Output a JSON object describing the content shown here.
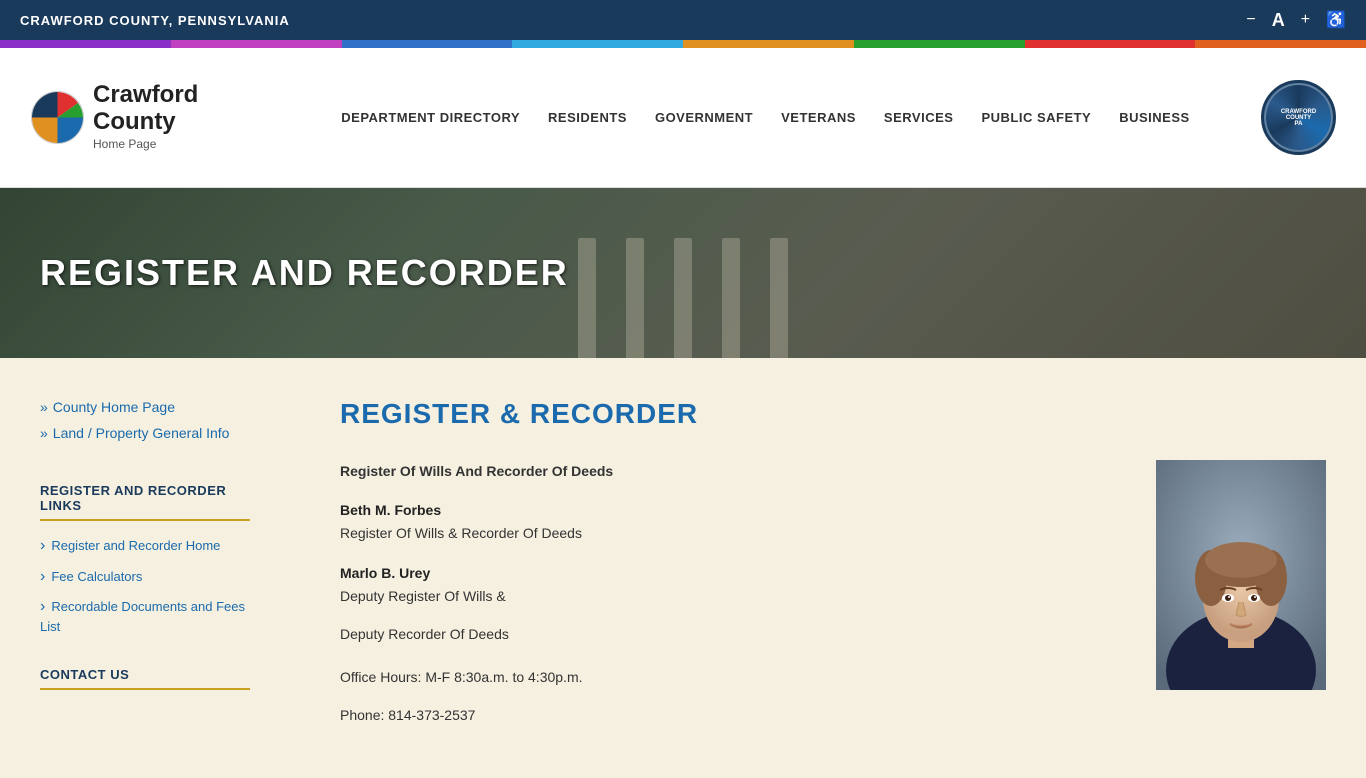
{
  "topBar": {
    "title": "CRAWFORD COUNTY, PENNSYLVANIA",
    "controls": {
      "decrease": "−",
      "font": "A",
      "increase": "+",
      "accessibility": "♿"
    }
  },
  "colorStripe": [
    "#8b2fc9",
    "#c040c0",
    "#3070c8",
    "#30a8e0",
    "#e09020",
    "#28a030",
    "#e03030",
    "#e06020"
  ],
  "logo": {
    "name": "Crawford",
    "name2": "County",
    "subtext": "Home Page"
  },
  "nav": {
    "items": [
      "DEPARTMENT DIRECTORY",
      "RESIDENTS",
      "GOVERNMENT",
      "VETERANS",
      "SERVICES",
      "PUBLIC SAFETY",
      "BUSINESS"
    ]
  },
  "hero": {
    "title": "REGISTER AND RECORDER"
  },
  "sidebar": {
    "breadcrumbs": [
      {
        "label": "County Home Page",
        "href": "#"
      },
      {
        "label": "Land / Property General Info",
        "href": "#"
      }
    ],
    "linksSection": {
      "title": "REGISTER AND RECORDER LINKS",
      "links": [
        {
          "label": "Register and Recorder Home",
          "href": "#"
        },
        {
          "label": "Fee Calculators",
          "href": "#"
        },
        {
          "label": "Recordable Documents and Fees List",
          "href": "#"
        }
      ]
    },
    "contactUs": {
      "title": "CONTACT US"
    }
  },
  "main": {
    "sectionTitle": "REGISTER & RECORDER",
    "intro": "Register Of Wills And Recorder Of Deeds",
    "person1": {
      "name": "Beth M. Forbes",
      "title": "Register Of Wills & Recorder Of Deeds"
    },
    "person2": {
      "name": "Marlo B. Urey",
      "title1": "Deputy Register Of Wills &",
      "title2": "Deputy Recorder Of Deeds"
    },
    "officeHours": "Office Hours: M-F 8:30a.m. to 4:30p.m.",
    "phone": "Phone: 814-373-2537"
  }
}
